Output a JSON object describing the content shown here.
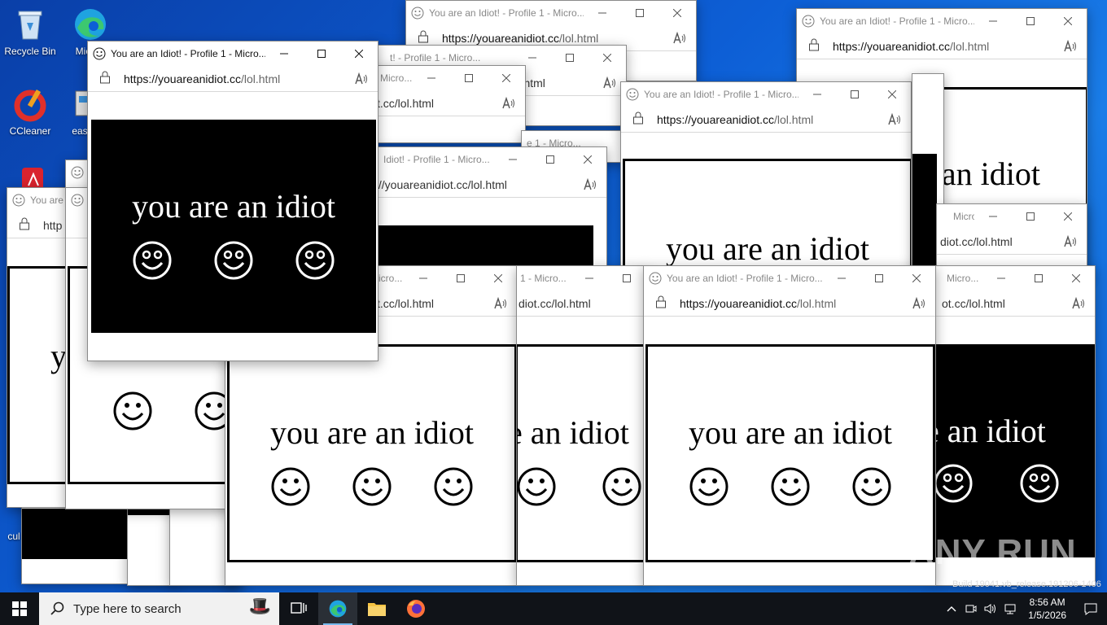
{
  "desktop": {
    "icons": [
      {
        "label": "Recycle Bin",
        "icon": "recycle-bin-icon"
      },
      {
        "label": "Mic Ed",
        "icon": "edge-icon"
      },
      {
        "label": "CCleaner",
        "icon": "ccleaner-icon"
      },
      {
        "label": "easy",
        "icon": "app-icon"
      },
      {
        "label": "",
        "icon": "acrobat-icon"
      },
      {
        "label": "cul",
        "icon": "app-icon"
      }
    ]
  },
  "popup": {
    "window_title": "You are an Idiot! - Profile 1 - Micro...",
    "url_host": "https://youareanidiot.cc",
    "url_path": "/lol.html",
    "message": "you are an idiot",
    "partial_titles": {
      "t1": "You are a",
      "t2": "t! - Profile 1 - Micro...",
      "t3": "Micro...",
      "t4": "Idiot! - Profile 1 - Micro...",
      "t5": "e 1 - Micro...",
      "t6": "- Micro...",
      "t7": "icro...",
      "t8": "1 - Micro...",
      "t9": "Micro..."
    },
    "partial_urls": {
      "u1": "http",
      "u2": "t.cc/lol.html",
      "u3": "://youareanidiot.cc/lol.html",
      "u4": "diot.cc/lol.html",
      "u5": "t.cc/lol.html",
      "u6": "iot.cc/lol.html",
      "u7": "ot.cc/lol.html",
      "u8": "idiot.cc/lol.html"
    },
    "partial_messages": {
      "m1": "y",
      "m2": "e an idiot",
      "m3": "an idiot"
    }
  },
  "taskbar": {
    "search_placeholder": "Type here to search",
    "time": "8:56 AM",
    "date": "1/5/2026",
    "pinned": [
      "task-view-icon",
      "edge-icon",
      "file-explorer-icon",
      "firefox-icon"
    ]
  },
  "watermark": {
    "text": "ANY RUN",
    "build": "Build 19041.vb_release.191206-1406"
  }
}
